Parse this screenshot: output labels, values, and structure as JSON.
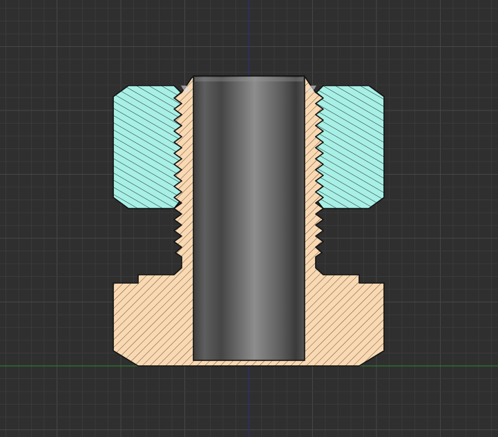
{
  "viewport": {
    "background": "#2f2f2f",
    "grid_minor_color": "#3a3a3a",
    "grid_major_color": "#474747",
    "axis_x_color": "#2e8b2e",
    "axis_y_color": "#2e2e8b"
  },
  "parts": {
    "nut": {
      "fill": "#a8f0e6",
      "hatch": "#102020",
      "outline": "#111111"
    },
    "bushing": {
      "fill": "#f8d9b3",
      "hatch": "#3a2a1a",
      "outline": "#111111"
    },
    "pin": {
      "shade_dark": "#3e3e3e",
      "shade_mid": "#6b6b6b",
      "shade_light": "#8d8d8d"
    }
  }
}
